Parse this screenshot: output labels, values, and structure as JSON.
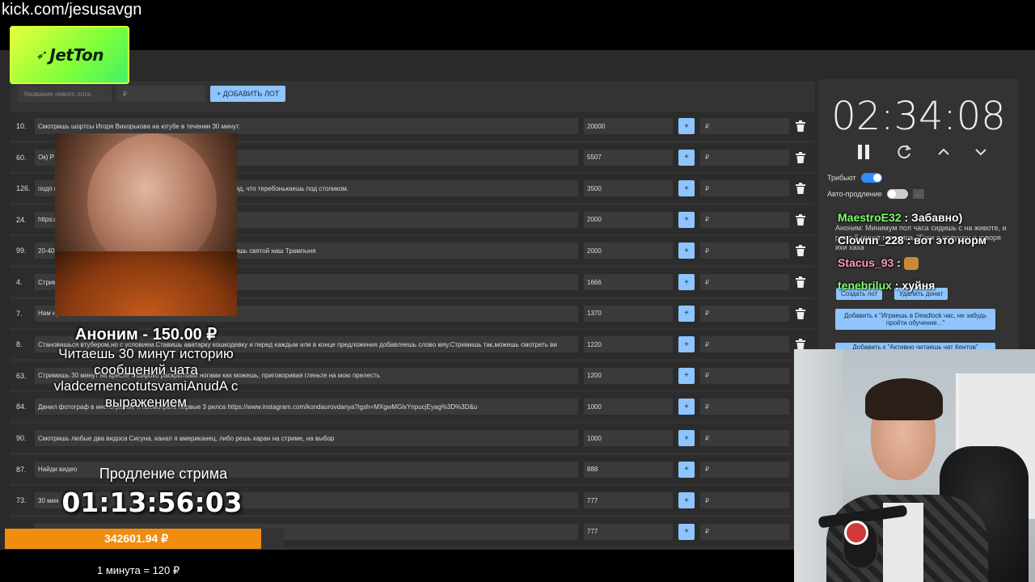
{
  "stream_url": "kick.com/jesusavgn",
  "logo_text": "JetTon",
  "add_lot": {
    "name_placeholder": "Название нового лота",
    "amount_placeholder": "₽",
    "button_label": "+ ДОБАВИТЬ ЛОТ"
  },
  "currency": "₽",
  "plus_label": "+",
  "lots": [
    {
      "num": "10.",
      "desc": "Смотришь шортсы Игоря Вихорькова на ютубе в течении 30 минут.",
      "amount": "20000"
    },
    {
      "num": "60.",
      "desc": "Ок) Р",
      "amount": "5507"
    },
    {
      "num": "126.",
      "desc": "подп                                                                             ваешь посты и сторис лайкая и коментируя. Иногда делай вид, что теребонькаешь под столиком.",
      "amount": "3500"
    },
    {
      "num": "24.",
      "desc": "https:/",
      "amount": "2000"
    },
    {
      "num": "99.",
      "desc": "20-40                                                                               кий рок стоя и вставешь на колени, молишься и потом кричишь святой наш Трампыня",
      "amount": "2000"
    },
    {
      "num": "4.",
      "desc": "Стрим",
      "amount": "1666"
    },
    {
      "num": "7.",
      "desc": "Нам ну",
      "amount": "1370"
    },
    {
      "num": "8.",
      "desc": "Становишься втубером,но с условием.Ставишь аватарку кошкодевку и перед каждым или в конце предложения добавляешь слово мяу.Стримишь так,можешь смотреть ви",
      "amount": "1220"
    },
    {
      "num": "63.",
      "desc": "Стримишь 30 минут на кресле с широко раскрытыми ногами как можешь, приговоривая гляньте на мою прелесть",
      "amount": "1200"
    },
    {
      "num": "84.",
      "desc": "Данил фотограф              в инстограмме и посмотреть первые 3 рилса https://www.instagram.com/kondaurovdanya?igsh=MXgwMGlxYnpucjEyag%3D%3D&u",
      "amount": "1000"
    },
    {
      "num": "90.",
      "desc": "Смотришь любые два видоса Сисуна, канал я американец, либо решь каран на стриме, на выбор",
      "amount": "1000"
    },
    {
      "num": "87.",
      "desc": "Найди видео",
      "amount": "888"
    },
    {
      "num": "73.",
      "desc": "30 мин",
      "amount": "777"
    },
    {
      "num": "",
      "desc": "",
      "amount": "777"
    }
  ],
  "main_timer": "02:34:08",
  "tribute_label": "Трибьют",
  "auto_extend_label": "Авто-продление",
  "dots_label": "...",
  "create_lot_label": "Создать лот",
  "delete_donation_label": "Удалить донат",
  "under_chat_text": "Аноним: Минимум пол часа сидишь с                 на животе, и раз в 5 минут говоришь \"Гуси             я подушку и говоря             ихи хаха",
  "action1_label": "Добавить к \"Играешь в Deadlock час, не забудь пройти обучение...\"",
  "action2_label": "Добавить к \"Активно читаешь чат Кентов\"",
  "chat": [
    {
      "user": "MaestroE32",
      "color": "green",
      "msg": "Забавно)"
    },
    {
      "user": "Clownn_228",
      "color": "white",
      "msg": "вот это норм"
    },
    {
      "user": "Stacus_93",
      "color": "pink",
      "msg": ""
    },
    {
      "user": "tenebrilux",
      "color": "green",
      "msg": "хуйня"
    }
  ],
  "chat_separator": " : ",
  "donation": {
    "donor": "Аноним - 150.00 ₽",
    "text": "Читаешь 30 минут историю сообщений чата vladcernencotutsvamiAnudA с выражением"
  },
  "extension_label": "Продление стрима",
  "extension_timer": "01:13:56:03",
  "total_amount": "342601.94 ₽",
  "progress_fraction": 0.92,
  "rate_text": "1 минута = 120 ₽",
  "colors": {
    "accent": "#8ec5ff",
    "progress": "#f08c10",
    "toggle_on": "#2e8cff"
  }
}
